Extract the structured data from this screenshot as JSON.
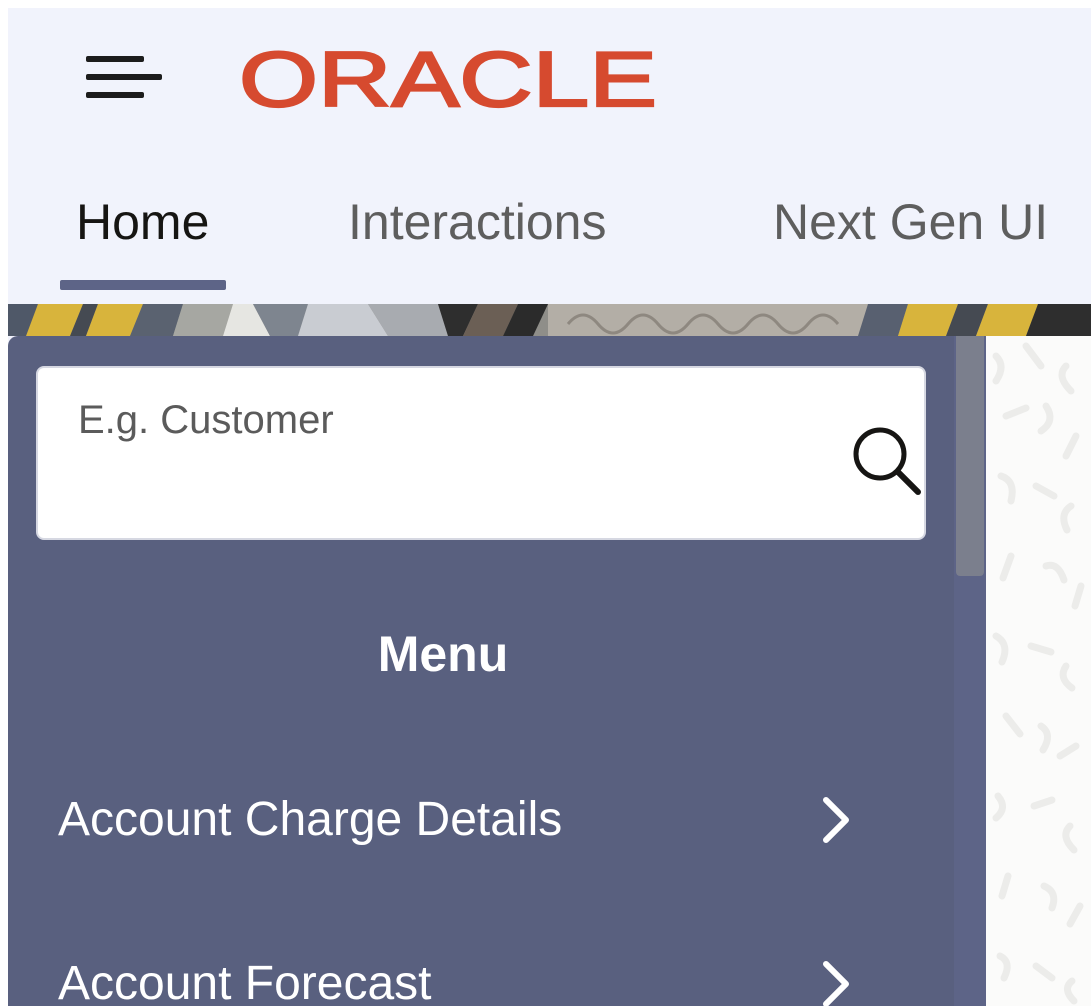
{
  "header": {
    "menu_icon": "hamburger-menu-icon",
    "logo_text": "ORACLE",
    "logo_color": "#d64a2f"
  },
  "tabs": [
    {
      "label": "Home",
      "active": true
    },
    {
      "label": "Interactions",
      "active": false
    },
    {
      "label": "Next Gen UI",
      "active": false
    }
  ],
  "sidebar": {
    "search": {
      "placeholder": "E.g. Customer",
      "value": "",
      "icon": "search-icon"
    },
    "menu_title": "Menu",
    "items": [
      {
        "label": "Account Charge Details",
        "icon": "chevron-right-icon"
      },
      {
        "label": "Account Forecast",
        "icon": "chevron-right-icon"
      }
    ]
  },
  "colors": {
    "header_bg": "#f1f3fc",
    "sidebar_bg": "#59607f",
    "tab_underline": "#5d6487",
    "brand_red": "#d64a2f"
  }
}
